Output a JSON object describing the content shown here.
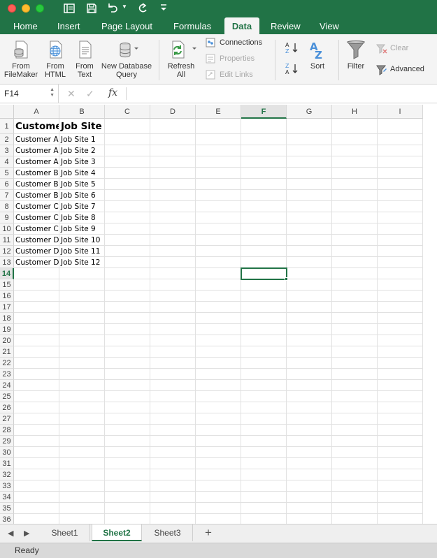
{
  "window": {
    "quick_access": [
      "sidebar-icon",
      "save-icon",
      "undo-icon",
      "redo-icon",
      "customize-icon"
    ]
  },
  "ribbon_tabs": [
    {
      "label": "Home"
    },
    {
      "label": "Insert"
    },
    {
      "label": "Page Layout"
    },
    {
      "label": "Formulas"
    },
    {
      "label": "Data",
      "active": true
    },
    {
      "label": "Review"
    },
    {
      "label": "View"
    }
  ],
  "ribbon": {
    "from_filemaker": {
      "line1": "From",
      "line2": "FileMaker"
    },
    "from_html": {
      "line1": "From",
      "line2": "HTML"
    },
    "from_text": {
      "line1": "From",
      "line2": "Text"
    },
    "new_db_query": {
      "line1": "New Database",
      "line2": "Query"
    },
    "refresh_all": {
      "line1": "Refresh",
      "line2": "All"
    },
    "connections": "Connections",
    "properties": "Properties",
    "edit_links": "Edit Links",
    "sort": "Sort",
    "filter": "Filter",
    "clear": "Clear",
    "advanced": "Advanced"
  },
  "formula_bar": {
    "name_box": "F14",
    "cancel_symbol": "✕",
    "enter_symbol": "✓",
    "fx_label": "fx",
    "value": ""
  },
  "grid": {
    "columns": [
      "A",
      "B",
      "C",
      "D",
      "E",
      "F",
      "G",
      "H",
      "I"
    ],
    "active_column": "F",
    "active_row": 14,
    "row_count": 36,
    "header_row": [
      "Customer",
      "Job Site"
    ],
    "rows": [
      [
        "Customer A",
        "Job Site 1"
      ],
      [
        "Customer A",
        "Job Site 2"
      ],
      [
        "Customer A",
        "Job Site 3"
      ],
      [
        "Customer B",
        "Job Site 4"
      ],
      [
        "Customer B",
        "Job Site 5"
      ],
      [
        "Customer B",
        "Job Site 6"
      ],
      [
        "Customer C",
        "Job Site 7"
      ],
      [
        "Customer C",
        "Job Site 8"
      ],
      [
        "Customer C",
        "Job Site 9"
      ],
      [
        "Customer D",
        "Job Site 10"
      ],
      [
        "Customer D",
        "Job Site 11"
      ],
      [
        "Customer D",
        "Job Site 12"
      ]
    ]
  },
  "sheets": {
    "tabs": [
      "Sheet1",
      "Sheet2",
      "Sheet3"
    ],
    "active": "Sheet2",
    "add_symbol": "+"
  },
  "status": {
    "text": "Ready"
  },
  "colors": {
    "accent": "#217346",
    "ribbon_bg": "#f4f4f4",
    "grid_line": "#e1e1e1"
  }
}
